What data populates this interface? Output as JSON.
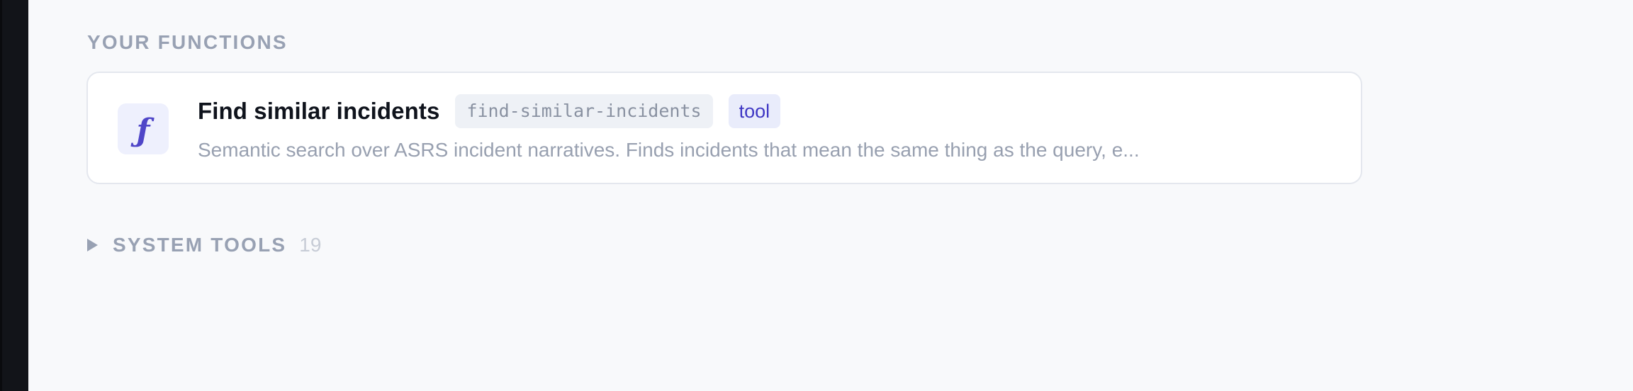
{
  "sections": {
    "your_functions": {
      "title": "YOUR FUNCTIONS",
      "items": [
        {
          "icon": "function-icon",
          "icon_glyph": "ƒ",
          "title": "Find similar incidents",
          "slug": "find-similar-incidents",
          "type": "tool",
          "description": "Semantic search over ASRS incident narratives. Finds incidents that mean the same thing as the query, e..."
        }
      ]
    },
    "system_tools": {
      "toggle_icon": "triangle-right-icon",
      "title": "SYSTEM TOOLS",
      "count": "19"
    }
  },
  "colors": {
    "background": "#f8f9fb",
    "rail": "#121419",
    "accent": "#4f46c8",
    "muted_text": "#98a1b3"
  }
}
